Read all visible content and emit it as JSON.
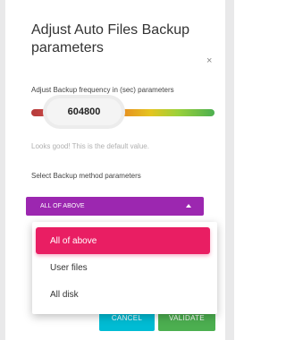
{
  "dialog": {
    "title": "Adjust Auto Files Backup parameters",
    "close_icon": "close-icon",
    "close_glyph": "×"
  },
  "frequency": {
    "label": "Adjust Backup frequency in (sec) parameters",
    "value": "604800",
    "hint": "Looks good! This is the default value."
  },
  "method": {
    "label": "Select Backup method parameters",
    "selected": "ALL OF ABOVE",
    "options": [
      "All of above",
      "User files",
      "All disk"
    ]
  },
  "buttons": {
    "cancel": "CANCEL",
    "validate": "VALIDATE"
  },
  "colors": {
    "select_bg": "#9c27b0",
    "active_option": "#e91e63",
    "cancel_bg": "#00bcd4",
    "validate_bg": "#4caf50"
  }
}
